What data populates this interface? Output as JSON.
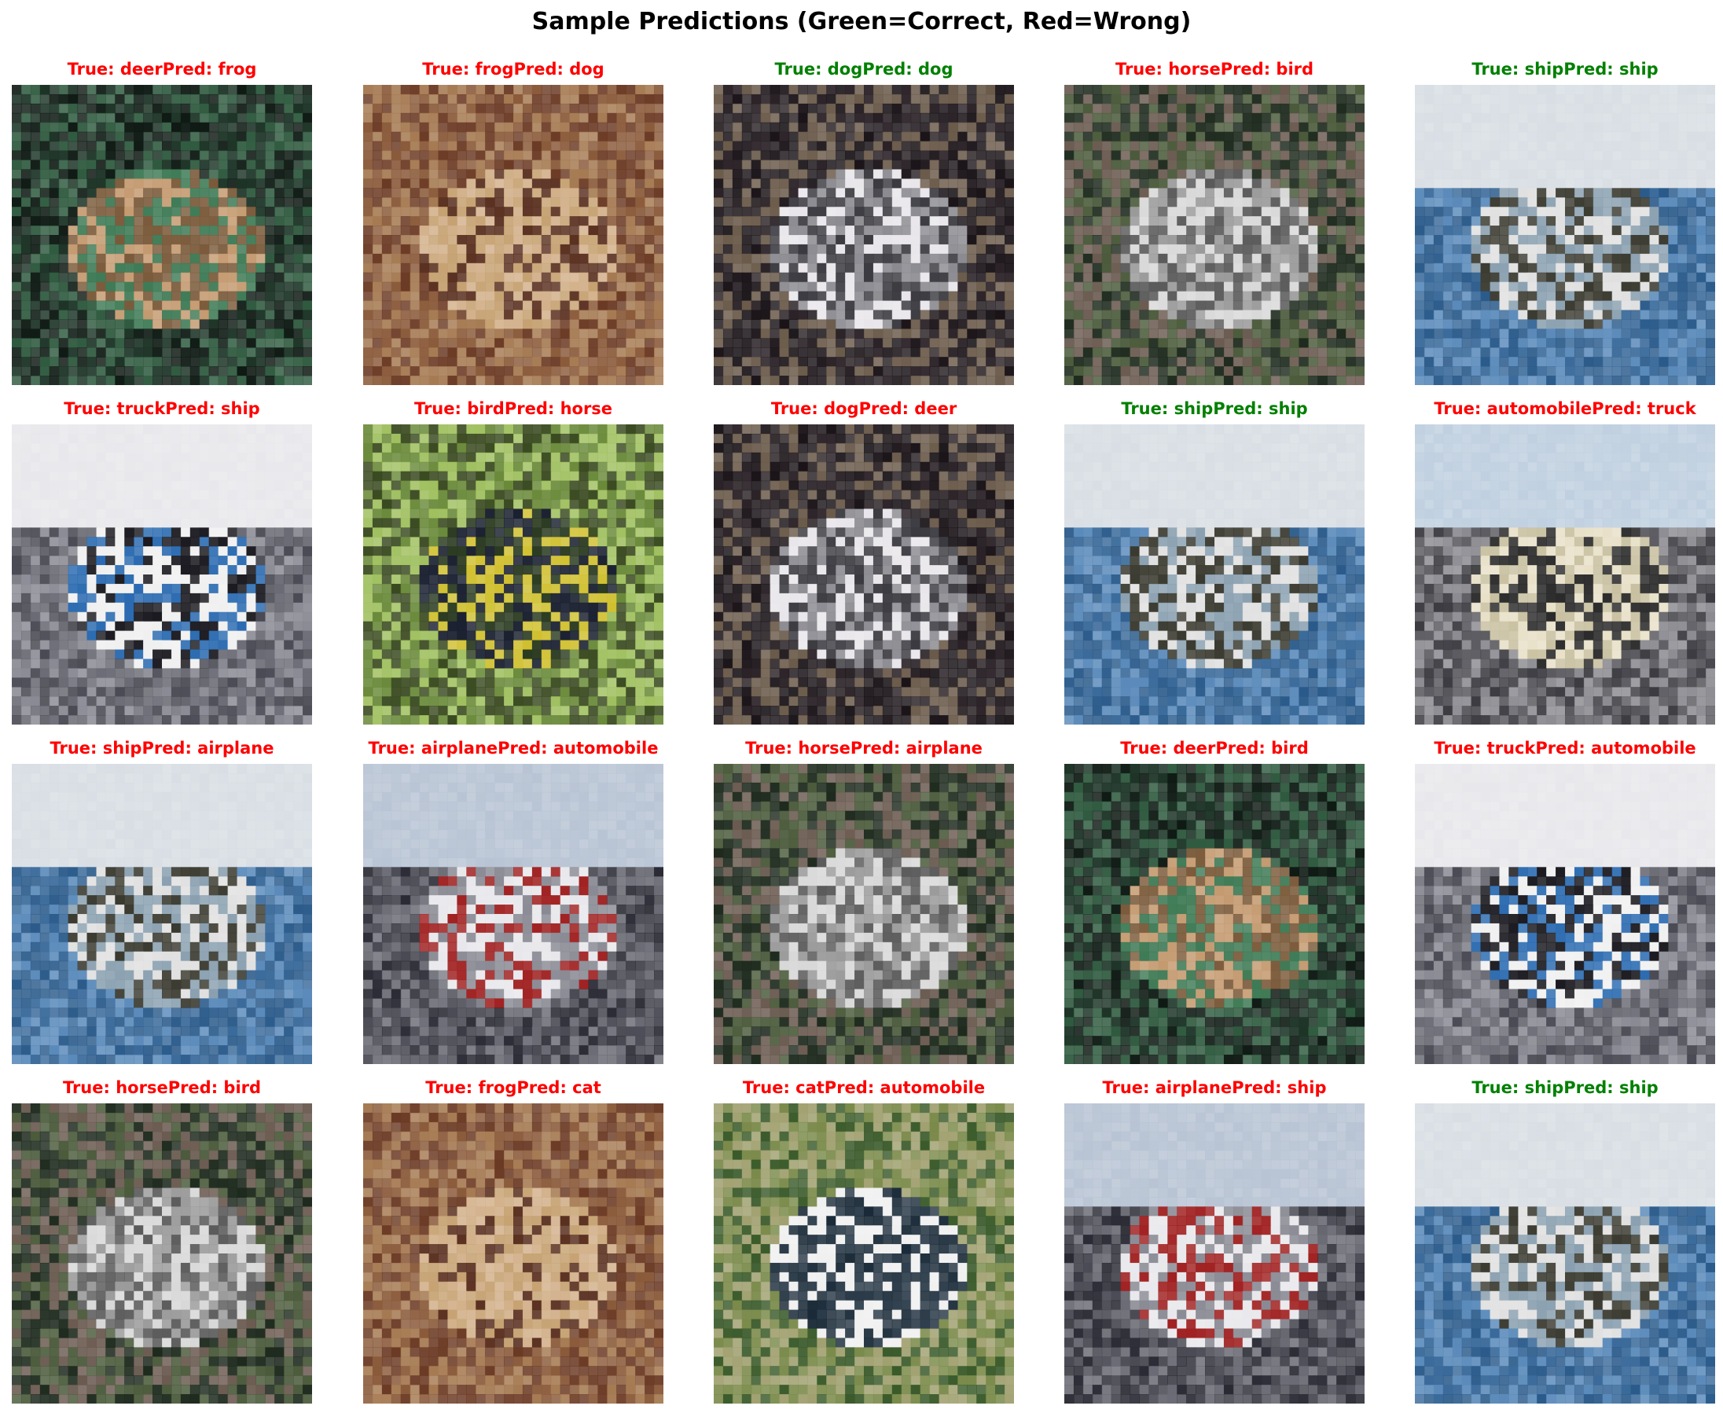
{
  "title": "Sample Predictions (Green=Correct, Red=Wrong)",
  "colors": {
    "correct": "#008000",
    "wrong": "#ff0000"
  },
  "predictions": [
    {
      "label": "True: deerPred: frog",
      "correct": false,
      "subject": "deer"
    },
    {
      "label": "True: frogPred: dog",
      "correct": false,
      "subject": "frog"
    },
    {
      "label": "True: dogPred: dog",
      "correct": true,
      "subject": "dog"
    },
    {
      "label": "True: horsePred: bird",
      "correct": false,
      "subject": "horse"
    },
    {
      "label": "True: shipPred: ship",
      "correct": true,
      "subject": "ship"
    },
    {
      "label": "True: truckPred: ship",
      "correct": false,
      "subject": "truck"
    },
    {
      "label": "True: birdPred: horse",
      "correct": false,
      "subject": "bird"
    },
    {
      "label": "True: dogPred: deer",
      "correct": false,
      "subject": "dog"
    },
    {
      "label": "True: shipPred: ship",
      "correct": true,
      "subject": "ship"
    },
    {
      "label": "True: automobilePred: truck",
      "correct": false,
      "subject": "automobile"
    },
    {
      "label": "True: shipPred: airplane",
      "correct": false,
      "subject": "ship"
    },
    {
      "label": "True: airplanePred: automobile",
      "correct": false,
      "subject": "airplane"
    },
    {
      "label": "True: horsePred: airplane",
      "correct": false,
      "subject": "horse"
    },
    {
      "label": "True: deerPred: bird",
      "correct": false,
      "subject": "deer"
    },
    {
      "label": "True: truckPred: automobile",
      "correct": false,
      "subject": "truck"
    },
    {
      "label": "True: horsePred: bird",
      "correct": false,
      "subject": "horse"
    },
    {
      "label": "True: frogPred: cat",
      "correct": false,
      "subject": "frog"
    },
    {
      "label": "True: catPred: automobile",
      "correct": false,
      "subject": "cat"
    },
    {
      "label": "True: airplanePred: ship",
      "correct": false,
      "subject": "airplane"
    },
    {
      "label": "True: shipPred: ship",
      "correct": true,
      "subject": "ship"
    }
  ]
}
